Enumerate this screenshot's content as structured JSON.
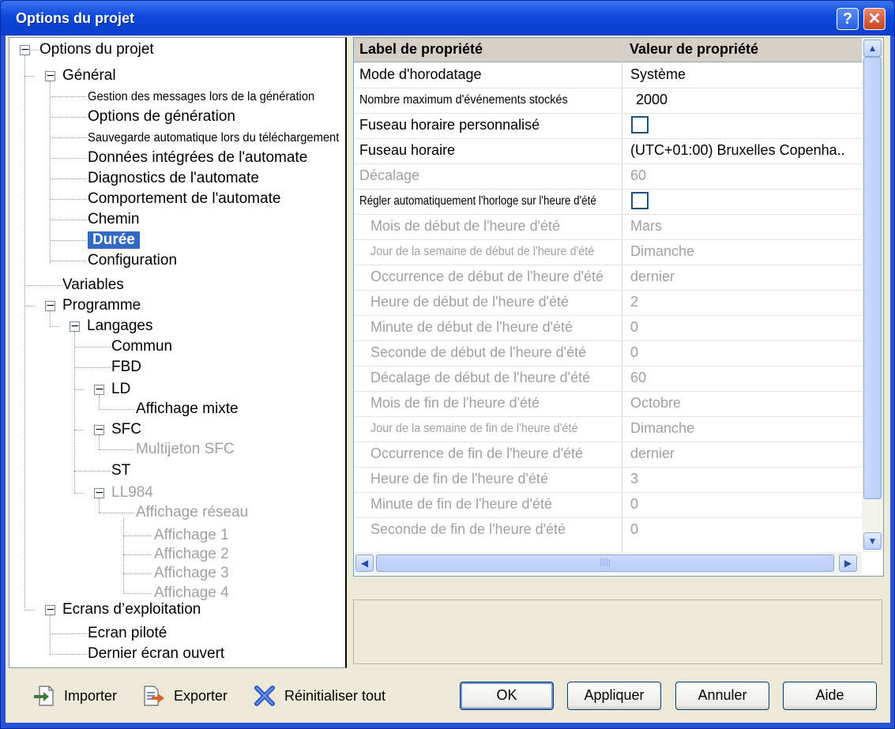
{
  "window": {
    "title": "Options du projet",
    "help_glyph": "?",
    "close_glyph": "✕"
  },
  "tree": {
    "root": "Options du projet",
    "general": "Général",
    "general_items": [
      "Gestion des messages lors de la génération",
      "Options de génération",
      "Sauvegarde automatique lors du téléchargement",
      "Données intégrées de l'automate",
      "Diagnostics de l'automate",
      "Comportement de l'automate",
      "Chemin",
      "Durée",
      "Configuration"
    ],
    "variables": "Variables",
    "programme": "Programme",
    "langages": "Langages",
    "commun": "Commun",
    "fbd": "FBD",
    "ld": "LD",
    "affichage_mixte": "Affichage mixte",
    "sfc": "SFC",
    "multijeton_sfc": "Multijeton SFC",
    "st": "ST",
    "ll984": "LL984",
    "affichage_reseau": "Affichage réseau",
    "affichages": [
      "Affichage 1",
      "Affichage 2",
      "Affichage 3",
      "Affichage 4"
    ],
    "ecrans": "Ecrans d’exploitation",
    "ecran_pilote": "Ecran piloté",
    "dernier_ecran": "Dernier écran ouvert"
  },
  "grid": {
    "col_label": "Label de propriété",
    "col_value": "Valeur de propriété",
    "rows": [
      {
        "label": "Mode d'horodatage",
        "value": "Système"
      },
      {
        "label": "Nombre maximum d'événements stockés",
        "value": "2000"
      },
      {
        "label": "Fuseau horaire personnalisé",
        "value": ""
      },
      {
        "label": "Fuseau horaire",
        "value": "(UTC+01:00) Bruxelles Copenha.."
      },
      {
        "label": "Décalage",
        "value": "60"
      },
      {
        "label": "Régler automatiquement l'horloge sur l'heure d'été",
        "value": ""
      },
      {
        "label": "Mois de début de l'heure d'été",
        "value": "Mars"
      },
      {
        "label": "Jour de la semaine de début de l'heure d'été",
        "value": "Dimanche"
      },
      {
        "label": "Occurrence de début de l'heure d'été",
        "value": "dernier"
      },
      {
        "label": "Heure de début de l'heure d'été",
        "value": "2"
      },
      {
        "label": "Minute de début de l'heure d'été",
        "value": "0"
      },
      {
        "label": "Seconde de début de l'heure d'été",
        "value": "0"
      },
      {
        "label": "Décalage de début de l'heure d'été",
        "value": "60"
      },
      {
        "label": "Mois de fin de l'heure d'été",
        "value": "Octobre"
      },
      {
        "label": "Jour de la semaine de fin de l'heure d'été",
        "value": "Dimanche"
      },
      {
        "label": "Occurrence de fin de l'heure d'été",
        "value": "dernier"
      },
      {
        "label": "Heure de fin de l'heure d'été",
        "value": "3"
      },
      {
        "label": "Minute de fin de l'heure d'été",
        "value": "0"
      },
      {
        "label": "Seconde de fin de l'heure d'été",
        "value": "0"
      }
    ]
  },
  "toolbar": {
    "import": "Importer",
    "export": "Exporter",
    "reset": "Réinitialiser tout"
  },
  "buttons": {
    "ok": "OK",
    "apply": "Appliquer",
    "cancel": "Annuler",
    "help": "Aide"
  },
  "colors": {
    "title_bar": "#0b47dc",
    "selection": "#316ac5",
    "disabled_text": "#a0a0a0",
    "dialog_bg": "#ece9d8"
  }
}
